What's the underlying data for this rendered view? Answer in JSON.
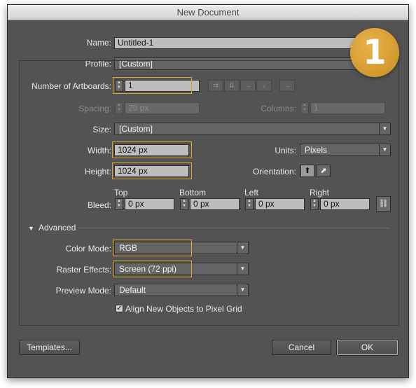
{
  "window": {
    "title": "New Document"
  },
  "step_badge": "1",
  "fields": {
    "name_label": "Name:",
    "name_value": "Untitled-1",
    "profile_label": "Profile:",
    "profile_value": "[Custom]",
    "artboards_label": "Number of Artboards:",
    "artboards_value": "1",
    "spacing_label": "Spacing:",
    "spacing_value": "20 px",
    "columns_label": "Columns:",
    "columns_value": "1",
    "size_label": "Size:",
    "size_value": "[Custom]",
    "width_label": "Width:",
    "width_value": "1024 px",
    "units_label": "Units:",
    "units_value": "Pixels",
    "height_label": "Height:",
    "height_value": "1024 px",
    "orientation_label": "Orientation:",
    "bleed_label": "Bleed:",
    "bleed_top_label": "Top",
    "bleed_top_value": "0 px",
    "bleed_bottom_label": "Bottom",
    "bleed_bottom_value": "0 px",
    "bleed_left_label": "Left",
    "bleed_left_value": "0 px",
    "bleed_right_label": "Right",
    "bleed_right_value": "0 px"
  },
  "advanced": {
    "toggle_label": "Advanced",
    "color_mode_label": "Color Mode:",
    "color_mode_value": "RGB",
    "raster_label": "Raster Effects:",
    "raster_value": "Screen (72 ppi)",
    "preview_label": "Preview Mode:",
    "preview_value": "Default",
    "align_checkbox_label": "Align New Objects to Pixel Grid",
    "align_checked": true
  },
  "buttons": {
    "templates": "Templates...",
    "cancel": "Cancel",
    "ok": "OK"
  },
  "icons": {
    "spin": "up-down-stepper-icon",
    "dropdown": "triangle-down-icon",
    "link": "chain-link-icon"
  },
  "colors": {
    "dialog_bg": "#535353",
    "highlight": "#e0a52d",
    "badge": "#d89e2c"
  }
}
